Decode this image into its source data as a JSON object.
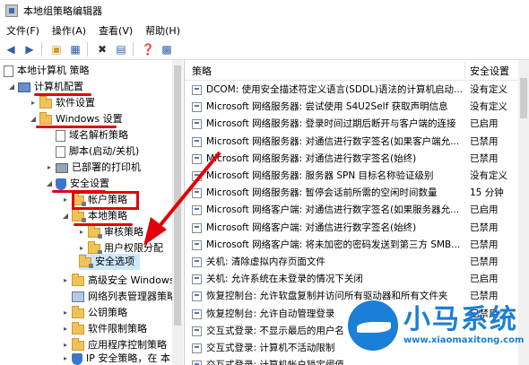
{
  "window": {
    "title": "本地组策略编辑器"
  },
  "menu": [
    "文件(F)",
    "操作(A)",
    "查看(V)",
    "帮助(H)"
  ],
  "tree": {
    "root": "本地计算机 策略",
    "computer_config": "计算机配置",
    "software_settings": "软件设置",
    "windows_settings": "Windows 设置",
    "name_resolution": "域名解析策略",
    "scripts": "脚本(启动/关机)",
    "printers": "已部署的打印机",
    "security_settings": "安全设置",
    "account_policies": "帐户策略",
    "local_policies": "本地策略",
    "audit_policy": "审核策略",
    "user_rights": "用户权限分配",
    "security_options": "安全选项",
    "advanced_security": "高级安全 Windows",
    "network_list": "网络列表管理器策略",
    "public_key": "公钥策略",
    "software_restriction": "软件限制策略",
    "app_control": "应用程序控制策略",
    "ip_security": "IP 安全策略，在 本"
  },
  "columns": {
    "policy": "策略",
    "setting": "安全设置"
  },
  "rows": [
    {
      "name": "DCOM: 使用安全描述符定义语言(SDDL)语法的计算机启动...",
      "value": "没有定义"
    },
    {
      "name": "Microsoft 网络服务器: 尝试使用 S4U2Self 获取声明信息",
      "value": "没有定义"
    },
    {
      "name": "Microsoft 网络服务器: 登录时间过期后断开与客户端的连接",
      "value": "已启用"
    },
    {
      "name": "Microsoft 网络服务器: 对通信进行数字签名(如果客户端允...",
      "value": "已禁用"
    },
    {
      "name": "Microsoft 网络服务器: 对通信进行数字签名(始终)",
      "value": "已禁用"
    },
    {
      "name": "Microsoft 网络服务器: 服务器 SPN 目标名称验证级别",
      "value": "没有定义"
    },
    {
      "name": "Microsoft 网络服务器: 暂停会话前所需的空闲时间数量",
      "value": "15 分钟"
    },
    {
      "name": "Microsoft 网络客户端: 对通信进行数字签名(如果服务器允...",
      "value": "已启用"
    },
    {
      "name": "Microsoft 网络客户端: 对通信进行数字签名(始终)",
      "value": "已禁用"
    },
    {
      "name": "Microsoft 网络客户端: 将未加密的密码发送到第三方 SMB...",
      "value": "已禁用"
    },
    {
      "name": "关机: 清除虚拟内存页面文件",
      "value": "已禁用"
    },
    {
      "name": "关机: 允许系统在未登录的情况下关闭",
      "value": "已启用"
    },
    {
      "name": "恢复控制台: 允许软盘复制并访问所有驱动器和所有文件夹",
      "value": "已禁用"
    },
    {
      "name": "恢复控制台: 允许自动管理登录",
      "value": "已禁用"
    },
    {
      "name": "交互式登录: 不显示最后的用户名",
      "value": ""
    },
    {
      "name": "交互式登录: 计算机不活动限制",
      "value": ""
    },
    {
      "name": "交互式登录: 计算机帐户锁定阈值",
      "value": ""
    }
  ],
  "watermark": {
    "name": "小马系统",
    "url": "www.xiaomaxitong.com"
  },
  "colors": {
    "highlight": "#e0000a",
    "selection": "#cce8ff",
    "brand": "#1a7fd6"
  }
}
